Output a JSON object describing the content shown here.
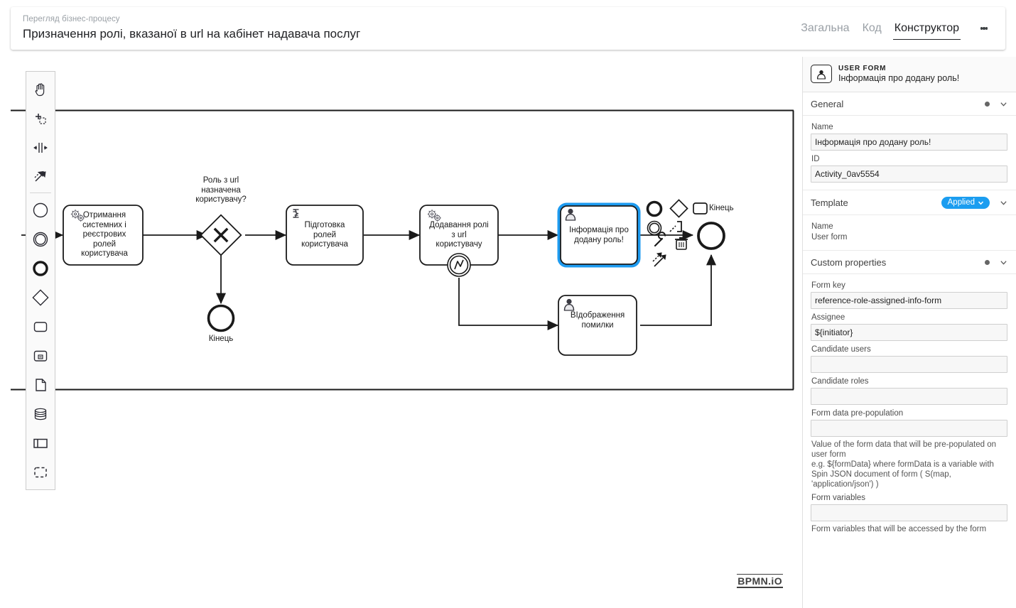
{
  "header": {
    "breadcrumb": "Перегляд бізнес-процесу",
    "title": "Призначення ролі, вказаної в url на кабінет надавача послуг",
    "tabs": [
      {
        "label": "Загальна",
        "active": false
      },
      {
        "label": "Код",
        "active": false
      },
      {
        "label": "Конструктор",
        "active": true
      }
    ],
    "menu_icon": "kebab-menu-icon"
  },
  "palette": {
    "items": [
      {
        "name": "hand-tool-icon",
        "label": "Activate the hand tool"
      },
      {
        "name": "lasso-tool-icon",
        "label": "Activate the lasso tool"
      },
      {
        "name": "space-tool-icon",
        "label": "Activate the create/remove space tool"
      },
      {
        "name": "global-connect-tool-icon",
        "label": "Activate the global connect tool"
      },
      {
        "name": "start-event-icon",
        "label": "Create StartEvent"
      },
      {
        "name": "intermediate-event-icon",
        "label": "Create Intermediate/Boundary Event"
      },
      {
        "name": "end-event-icon",
        "label": "Create EndEvent"
      },
      {
        "name": "gateway-icon",
        "label": "Create Gateway"
      },
      {
        "name": "task-icon",
        "label": "Create Task"
      },
      {
        "name": "subprocess-icon",
        "label": "Create expanded SubProcess"
      },
      {
        "name": "data-object-icon",
        "label": "Create DataObjectReference"
      },
      {
        "name": "data-store-icon",
        "label": "Create DataStoreReference"
      },
      {
        "name": "participant-icon",
        "label": "Create Pool/Participant"
      },
      {
        "name": "group-icon",
        "label": "Create Group"
      }
    ]
  },
  "diagram": {
    "watermark": "BPMN.iO",
    "nodes": [
      {
        "id": "task-get-roles",
        "type": "service-task",
        "label": "Отримання\nсистемних і\nреєстрових\nролей\nкористувача",
        "icon": "gears-icon"
      },
      {
        "id": "gateway-role",
        "type": "exclusive-gateway",
        "label": "X",
        "annotation": "Роль з url\nназначена\nкористувачу?"
      },
      {
        "id": "end-event-1",
        "type": "end-event",
        "label": "Кінець"
      },
      {
        "id": "task-prepare-roles",
        "type": "script-task",
        "label": "Підготовка\nролей\nкористувача",
        "icon": "script-icon"
      },
      {
        "id": "task-add-role",
        "type": "service-task",
        "label": "Додавання ролі\nз url\nкористувачу",
        "icon": "gears-icon",
        "boundary": "error-boundary-event"
      },
      {
        "id": "task-info-form",
        "type": "user-task",
        "label": "Інформація про\nдодану роль!",
        "icon": "user-icon",
        "selected": true
      },
      {
        "id": "task-show-error",
        "type": "user-task",
        "label": "ВІдображення\nпомилки",
        "icon": "user-icon"
      },
      {
        "id": "end-event-2",
        "type": "end-event",
        "label": ""
      }
    ],
    "context_pad": {
      "tooltip": "Кінець",
      "actions": [
        {
          "name": "append-end-event-icon"
        },
        {
          "name": "append-gateway-icon"
        },
        {
          "name": "append-task-icon"
        },
        {
          "name": "append-intermediate-event-icon"
        },
        {
          "name": "append-text-annotation-icon"
        },
        {
          "name": "change-type-wrench-icon"
        },
        {
          "name": "delete-trash-icon"
        },
        {
          "name": "connect-icon"
        }
      ]
    }
  },
  "properties": {
    "element_kind": "USER FORM",
    "element_name": "Інформація про додану роль!",
    "element_icon": "user-task-icon",
    "groups": {
      "general": {
        "title": "General",
        "fields": [
          {
            "label": "Name",
            "value": "Інформація про додану роль!"
          },
          {
            "label": "ID",
            "value": "Activity_0av5554"
          }
        ]
      },
      "template": {
        "title": "Template",
        "badge": "Applied",
        "name_label": "Name",
        "name_value": "User form"
      },
      "custom": {
        "title": "Custom properties",
        "fields": [
          {
            "label": "Form key",
            "value": "reference-role-assigned-info-form",
            "help": ""
          },
          {
            "label": "Assignee",
            "value": "${initiator}",
            "help": ""
          },
          {
            "label": "Candidate users",
            "value": "",
            "help": ""
          },
          {
            "label": "Candidate roles",
            "value": "",
            "help": ""
          },
          {
            "label": "Form data pre-population",
            "value": "",
            "help": "Value of the form data that will be pre-populated on user form\ne.g. ${formData} where formData is a variable with Spin JSON document of form ( S(map, 'application/json') )"
          },
          {
            "label": "Form variables",
            "value": "",
            "help": "Form variables that will be accessed by the form"
          }
        ]
      }
    }
  },
  "colors": {
    "accent": "#1b9df0",
    "selection": "#1e9bf0",
    "text": "#202124",
    "muted": "#9aa0a6"
  }
}
